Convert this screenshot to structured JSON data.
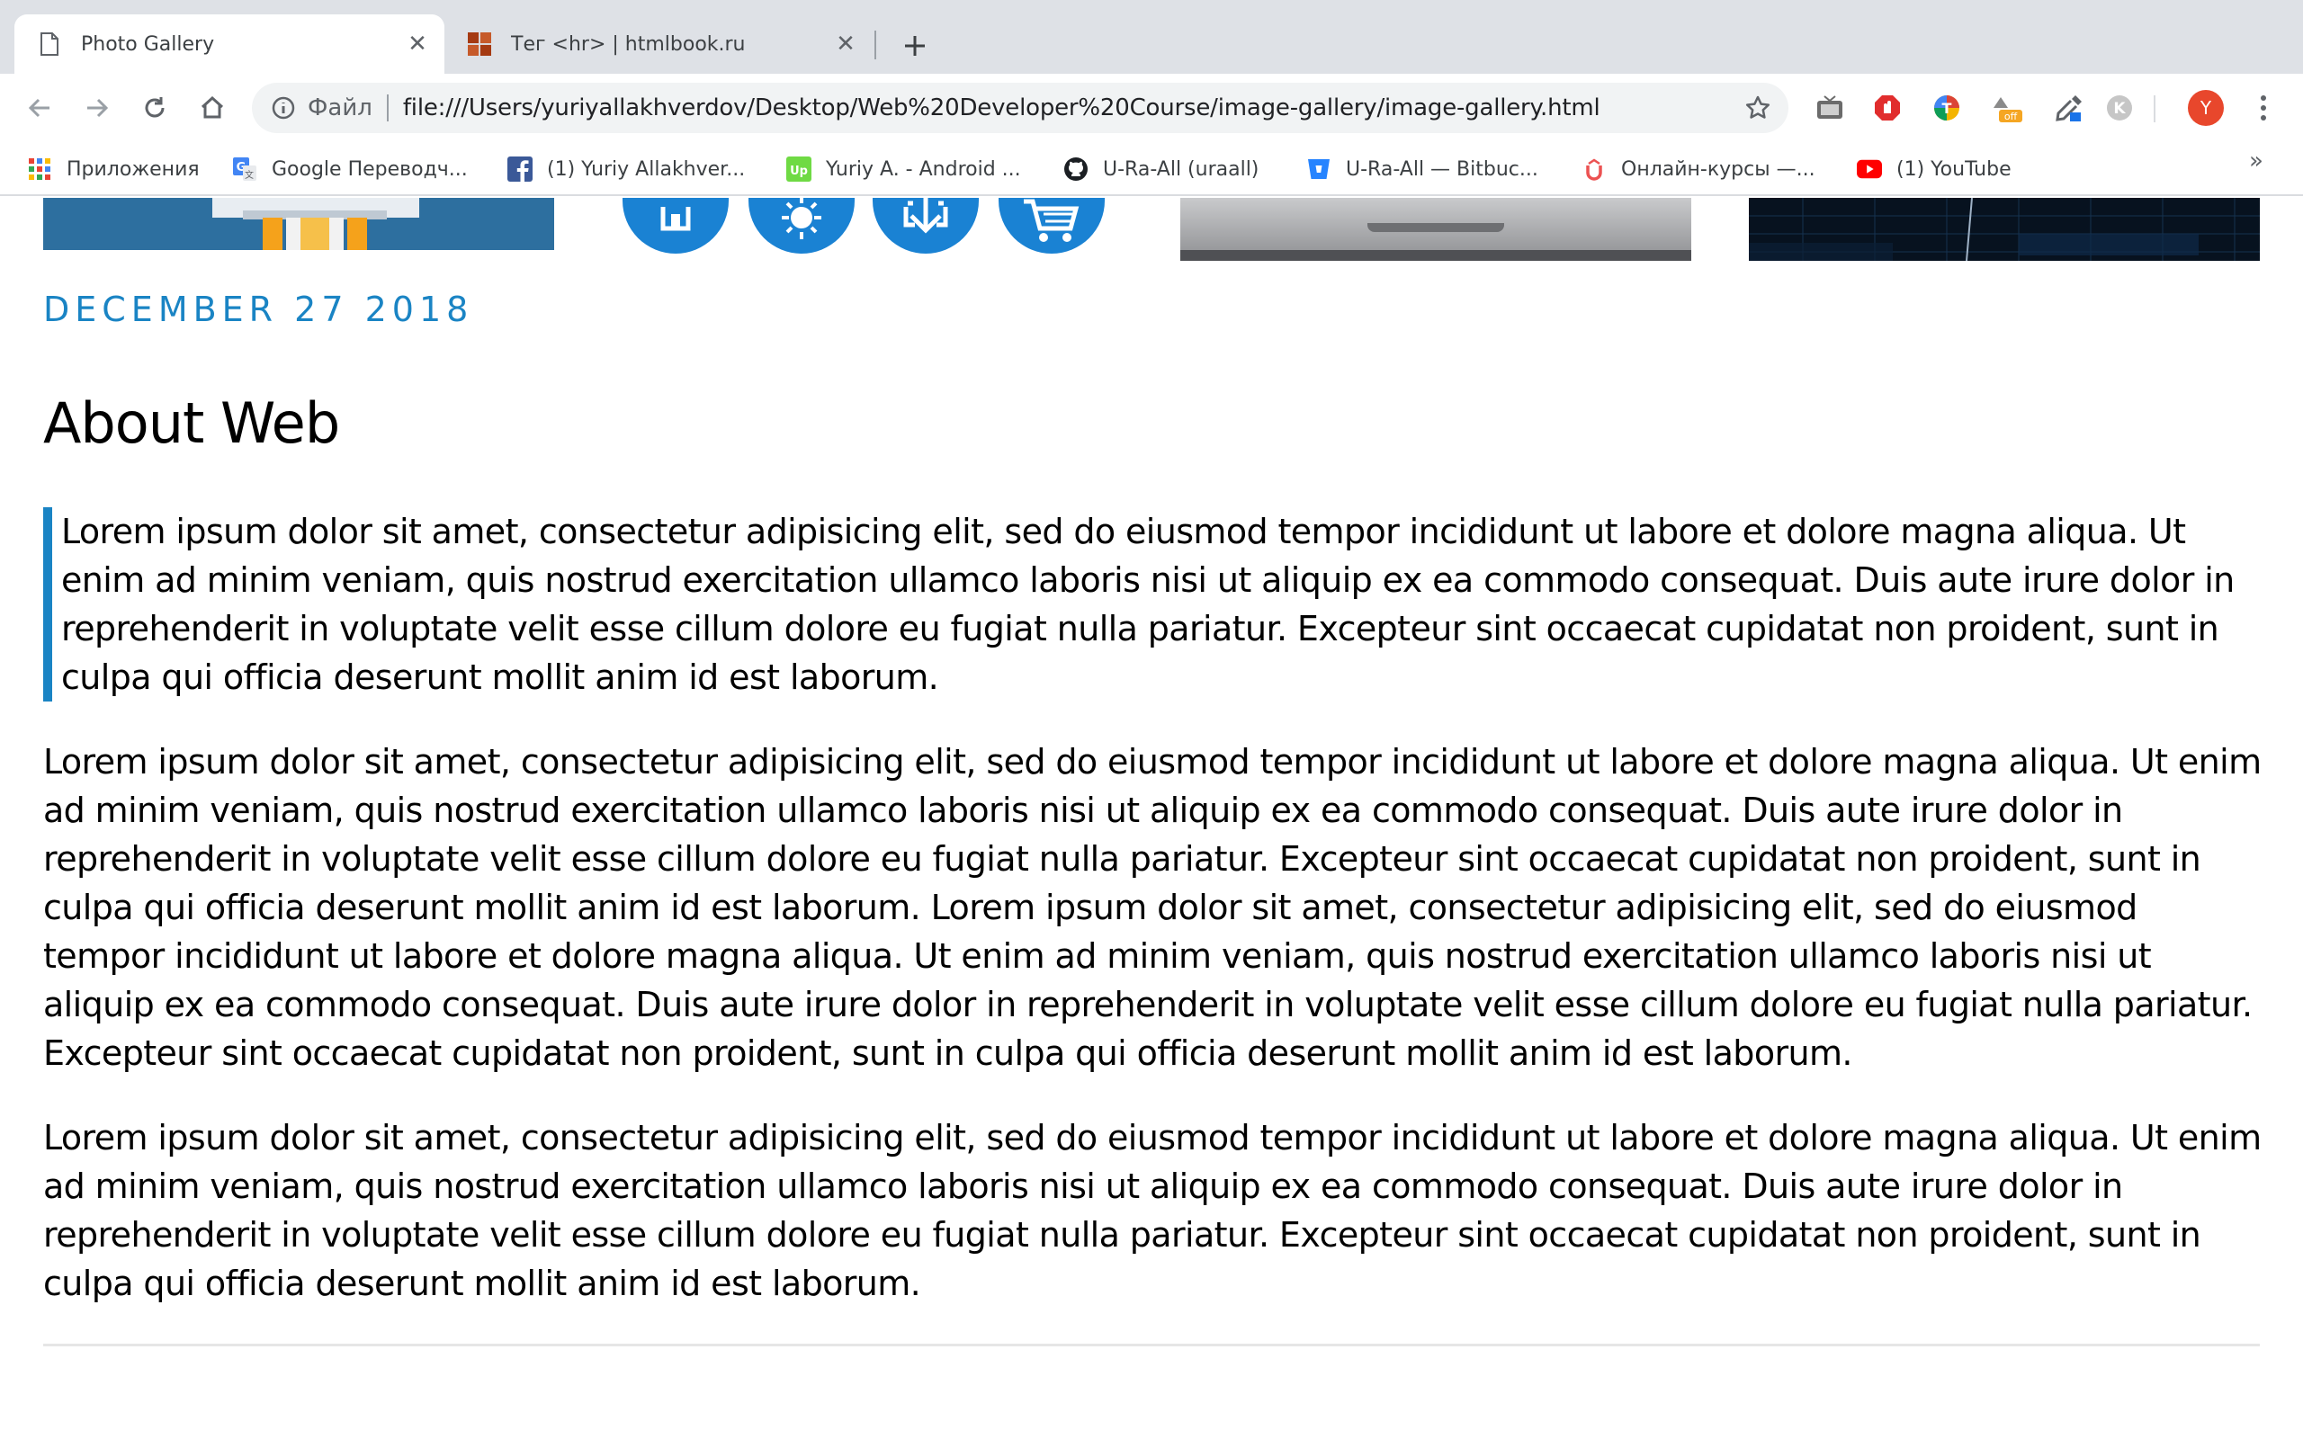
{
  "browser": {
    "tabs": [
      {
        "title": "Photo Gallery",
        "active": true,
        "icon": "page-icon"
      },
      {
        "title": "Тег <hr> | htmlbook.ru",
        "active": false,
        "icon": "htmlbook-icon"
      }
    ],
    "omnibox": {
      "scheme_label": "Файл",
      "url": "file:///Users/yuriyallakhverdov/Desktop/Web%20Developer%20Course/image-gallery/image-gallery.html"
    },
    "profile_initial": "Y",
    "bookmarks": [
      {
        "label": "Приложения",
        "icon": "apps-grid-icon"
      },
      {
        "label": "Google Переводч...",
        "icon": "google-translate-icon"
      },
      {
        "label": "(1) Yuriy Allakhver...",
        "icon": "facebook-icon"
      },
      {
        "label": "Yuriy A. - Android ...",
        "icon": "upwork-icon"
      },
      {
        "label": "U-Ra-All (uraall)",
        "icon": "github-icon"
      },
      {
        "label": "U-Ra-All — Bitbuc...",
        "icon": "bitbucket-icon"
      },
      {
        "label": "Онлайн-курсы —...",
        "icon": "udemy-icon"
      },
      {
        "label": "(1) YouTube",
        "icon": "youtube-icon"
      }
    ],
    "extension_badge": "off"
  },
  "colors": {
    "accent": "#1a84c4",
    "tabstrip": "#dee1e6",
    "omnibox": "#f1f3f4"
  },
  "page": {
    "date": "DECEMBER 27 2018",
    "title": "About Web",
    "blockquote": "Lorem ipsum dolor sit amet, consectetur adipisicing elit, sed do eiusmod tempor incididunt ut labore et dolore magna aliqua. Ut enim ad minim veniam, quis nostrud exercitation ullamco laboris nisi ut aliquip ex ea commodo consequat. Duis aute irure dolor in reprehenderit in voluptate velit esse cillum dolore eu fugiat nulla pariatur. Excepteur sint occaecat cupidatat non proident, sunt in culpa qui officia deserunt mollit anim id est laborum.",
    "paragraphs": [
      "Lorem ipsum dolor sit amet, consectetur adipisicing elit, sed do eiusmod tempor incididunt ut labore et dolore magna aliqua. Ut enim ad minim veniam, quis nostrud exercitation ullamco laboris nisi ut aliquip ex ea commodo consequat. Duis aute irure dolor in reprehenderit in voluptate velit esse cillum dolore eu fugiat nulla pariatur. Excepteur sint occaecat cupidatat non proident, sunt in culpa qui officia deserunt mollit anim id est laborum. Lorem ipsum dolor sit amet, consectetur adipisicing elit, sed do eiusmod tempor incididunt ut labore et dolore magna aliqua. Ut enim ad minim veniam, quis nostrud exercitation ullamco laboris nisi ut aliquip ex ea commodo consequat. Duis aute irure dolor in reprehenderit in voluptate velit esse cillum dolore eu fugiat nulla pariatur. Excepteur sint occaecat cupidatat non proident, sunt in culpa qui officia deserunt mollit anim id est laborum.",
      "Lorem ipsum dolor sit amet, consectetur adipisicing elit, sed do eiusmod tempor incididunt ut labore et dolore magna aliqua. Ut enim ad minim veniam, quis nostrud exercitation ullamco laboris nisi ut aliquip ex ea commodo consequat. Duis aute irure dolor in reprehenderit in voluptate velit esse cillum dolore eu fugiat nulla pariatur. Excepteur sint occaecat cupidatat non proident, sunt in culpa qui officia deserunt mollit anim id est laborum."
    ]
  }
}
